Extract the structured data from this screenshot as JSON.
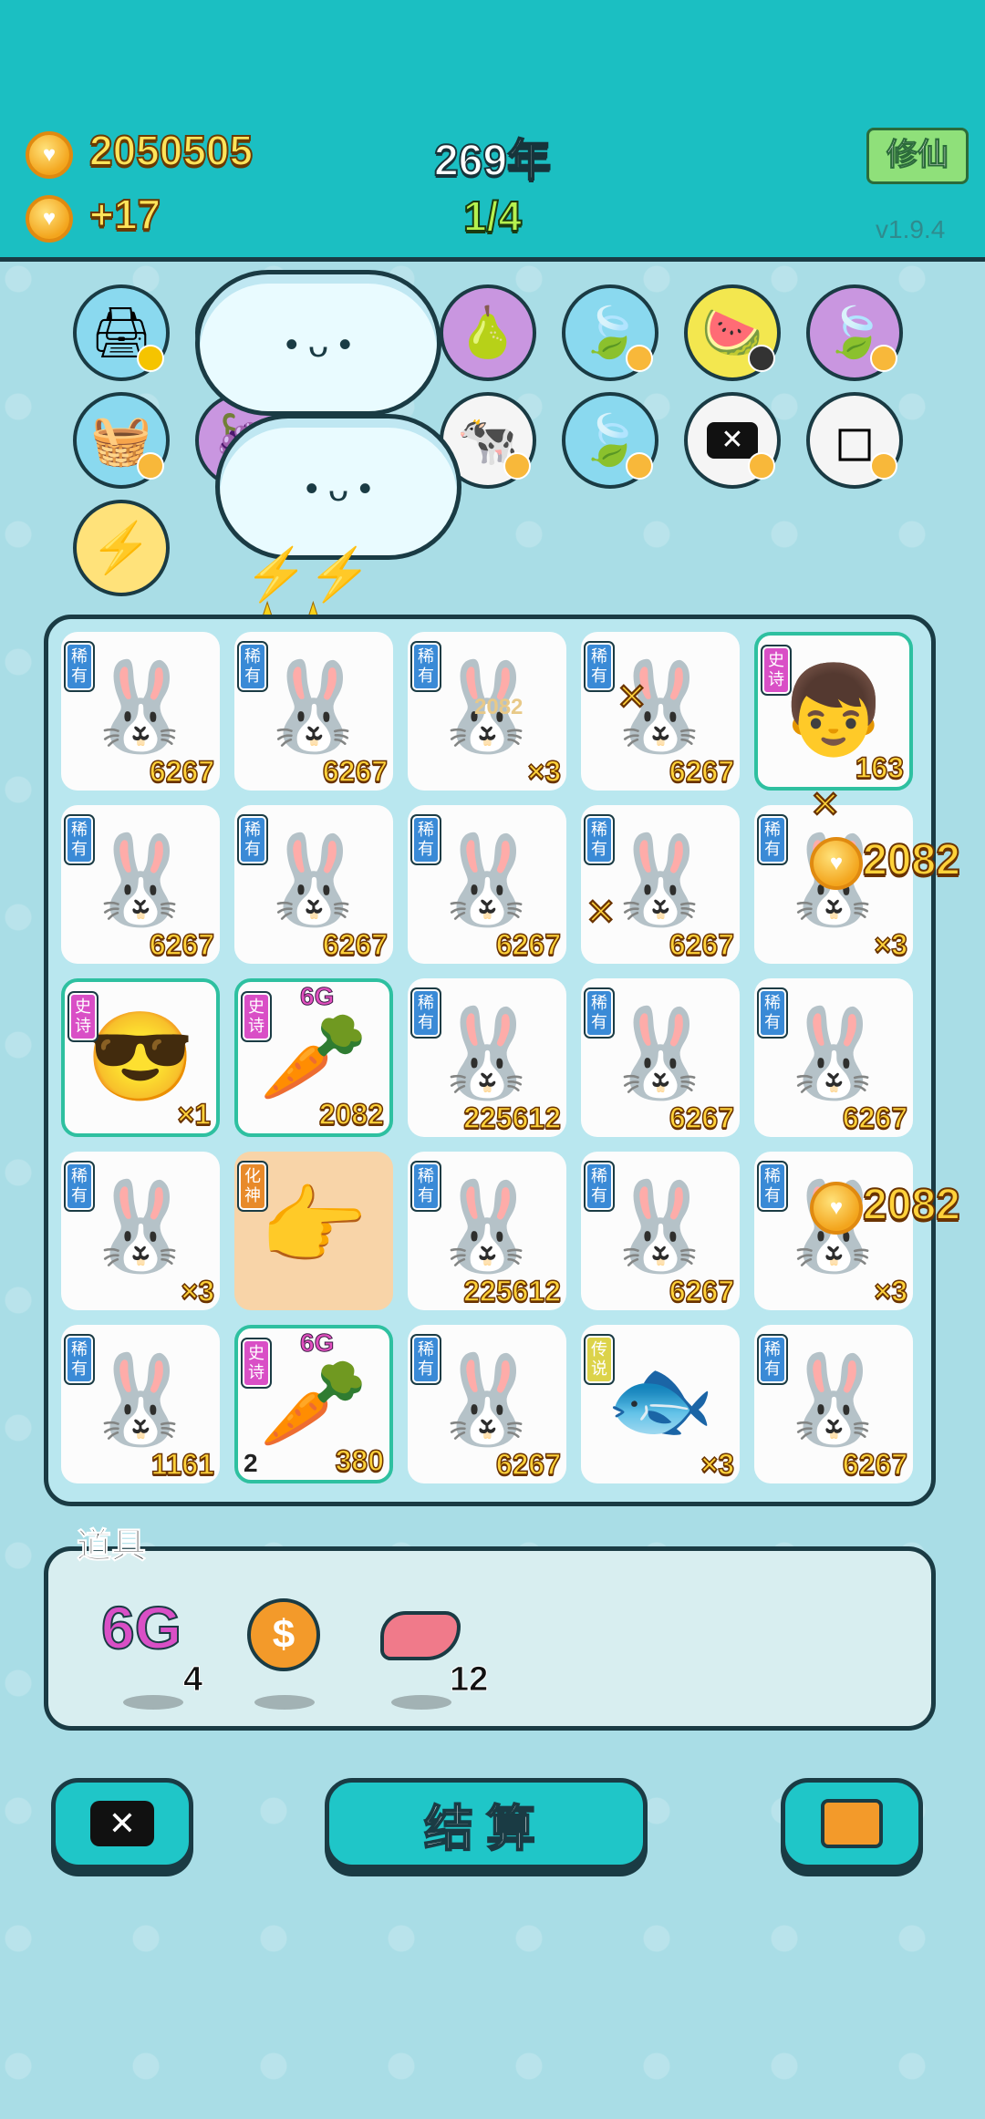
{
  "header": {
    "coins": "2050505",
    "income": "+17",
    "year": "269年",
    "progress": "1/4",
    "cultivate_button": "修仙",
    "version": "v1.9.4"
  },
  "relics": [
    {
      "name": "printer-icon"
    },
    {
      "name": "fruit-icon"
    },
    {
      "name": "pomelo-icon"
    },
    {
      "name": "leaf-icon"
    },
    {
      "name": "fruit-basket-icon"
    },
    {
      "name": "leaf-icon"
    },
    {
      "name": "basket-icon"
    },
    {
      "name": "cow-icon"
    },
    {
      "name": "leaf-icon"
    },
    {
      "name": "delete-icon"
    },
    {
      "name": "sugar-cube-icon"
    },
    {
      "name": "lightning-icon"
    }
  ],
  "board": {
    "cells": [
      {
        "tag": "稀有",
        "num": "6267",
        "kind": "bunny"
      },
      {
        "tag": "稀有",
        "num": "6267",
        "kind": "bunny"
      },
      {
        "tag": "稀有",
        "num": "×3",
        "kind": "bunny"
      },
      {
        "tag": "稀有",
        "num": "6267",
        "kind": "bunny"
      },
      {
        "tag": "史诗",
        "num": "163",
        "kind": "boy"
      },
      {
        "tag": "稀有",
        "num": "6267",
        "kind": "bunny"
      },
      {
        "tag": "稀有",
        "num": "6267",
        "kind": "bunny"
      },
      {
        "tag": "稀有",
        "num": "6267",
        "kind": "bunny"
      },
      {
        "tag": "稀有",
        "num": "6267",
        "kind": "bunny"
      },
      {
        "tag": "稀有",
        "num": "×3",
        "kind": "bunny"
      },
      {
        "tag": "史诗",
        "num": "×1",
        "kind": "man"
      },
      {
        "tag": "史诗",
        "num": "2082",
        "kind": "carrot",
        "top": "6G"
      },
      {
        "tag": "稀有",
        "num": "225612",
        "kind": "bunny"
      },
      {
        "tag": "稀有",
        "num": "6267",
        "kind": "bunny"
      },
      {
        "tag": "稀有",
        "num": "6267",
        "kind": "bunny"
      },
      {
        "tag": "稀有",
        "num": "×3",
        "kind": "bunny"
      },
      {
        "tag": "化神",
        "num": "",
        "kind": "hand"
      },
      {
        "tag": "稀有",
        "num": "225612",
        "kind": "bunny"
      },
      {
        "tag": "稀有",
        "num": "6267",
        "kind": "bunny"
      },
      {
        "tag": "稀有",
        "num": "×3",
        "kind": "bunny"
      },
      {
        "tag": "稀有",
        "num": "1161",
        "kind": "bunny"
      },
      {
        "tag": "史诗",
        "num": "380",
        "kind": "carrot",
        "top": "6G",
        "sub": "2"
      },
      {
        "tag": "稀有",
        "num": "6267",
        "kind": "bunny"
      },
      {
        "tag": "传说",
        "num": "×3",
        "kind": "koi"
      },
      {
        "tag": "稀有",
        "num": "6267",
        "kind": "bunny"
      }
    ],
    "floating": {
      "coin_a": "2082",
      "coin_b": "2082",
      "faint": "2082"
    }
  },
  "props": {
    "title": "道具",
    "items": [
      {
        "label": "6G",
        "count": "4"
      },
      {
        "label": "$",
        "count": ""
      },
      {
        "label": "",
        "count": "12"
      }
    ]
  },
  "buttons": {
    "settle": "结算"
  },
  "colors": {
    "header_bg": "#1bbfc2",
    "page_bg": "#a9dde6",
    "rare_tag": "#3a8ad6",
    "epic_tag": "#d94fc6",
    "legend_tag": "#dcd34a",
    "number_gold": "#ffd23a"
  }
}
